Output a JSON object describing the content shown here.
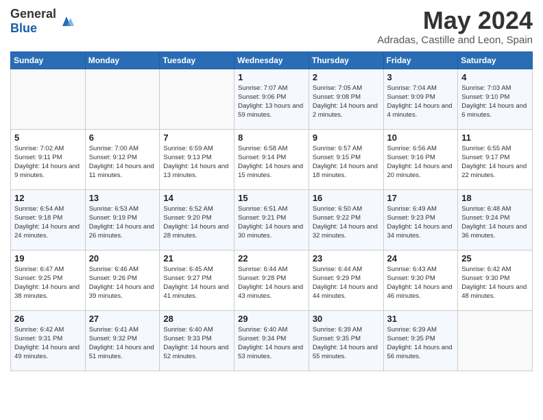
{
  "header": {
    "logo_general": "General",
    "logo_blue": "Blue",
    "month_title": "May 2024",
    "location": "Adradas, Castille and Leon, Spain"
  },
  "days_of_week": [
    "Sunday",
    "Monday",
    "Tuesday",
    "Wednesday",
    "Thursday",
    "Friday",
    "Saturday"
  ],
  "weeks": [
    [
      {
        "day": "",
        "sunrise": "",
        "sunset": "",
        "daylight": ""
      },
      {
        "day": "",
        "sunrise": "",
        "sunset": "",
        "daylight": ""
      },
      {
        "day": "",
        "sunrise": "",
        "sunset": "",
        "daylight": ""
      },
      {
        "day": "1",
        "sunrise": "Sunrise: 7:07 AM",
        "sunset": "Sunset: 9:06 PM",
        "daylight": "Daylight: 13 hours and 59 minutes."
      },
      {
        "day": "2",
        "sunrise": "Sunrise: 7:05 AM",
        "sunset": "Sunset: 9:08 PM",
        "daylight": "Daylight: 14 hours and 2 minutes."
      },
      {
        "day": "3",
        "sunrise": "Sunrise: 7:04 AM",
        "sunset": "Sunset: 9:09 PM",
        "daylight": "Daylight: 14 hours and 4 minutes."
      },
      {
        "day": "4",
        "sunrise": "Sunrise: 7:03 AM",
        "sunset": "Sunset: 9:10 PM",
        "daylight": "Daylight: 14 hours and 6 minutes."
      }
    ],
    [
      {
        "day": "5",
        "sunrise": "Sunrise: 7:02 AM",
        "sunset": "Sunset: 9:11 PM",
        "daylight": "Daylight: 14 hours and 9 minutes."
      },
      {
        "day": "6",
        "sunrise": "Sunrise: 7:00 AM",
        "sunset": "Sunset: 9:12 PM",
        "daylight": "Daylight: 14 hours and 11 minutes."
      },
      {
        "day": "7",
        "sunrise": "Sunrise: 6:59 AM",
        "sunset": "Sunset: 9:13 PM",
        "daylight": "Daylight: 14 hours and 13 minutes."
      },
      {
        "day": "8",
        "sunrise": "Sunrise: 6:58 AM",
        "sunset": "Sunset: 9:14 PM",
        "daylight": "Daylight: 14 hours and 15 minutes."
      },
      {
        "day": "9",
        "sunrise": "Sunrise: 6:57 AM",
        "sunset": "Sunset: 9:15 PM",
        "daylight": "Daylight: 14 hours and 18 minutes."
      },
      {
        "day": "10",
        "sunrise": "Sunrise: 6:56 AM",
        "sunset": "Sunset: 9:16 PM",
        "daylight": "Daylight: 14 hours and 20 minutes."
      },
      {
        "day": "11",
        "sunrise": "Sunrise: 6:55 AM",
        "sunset": "Sunset: 9:17 PM",
        "daylight": "Daylight: 14 hours and 22 minutes."
      }
    ],
    [
      {
        "day": "12",
        "sunrise": "Sunrise: 6:54 AM",
        "sunset": "Sunset: 9:18 PM",
        "daylight": "Daylight: 14 hours and 24 minutes."
      },
      {
        "day": "13",
        "sunrise": "Sunrise: 6:53 AM",
        "sunset": "Sunset: 9:19 PM",
        "daylight": "Daylight: 14 hours and 26 minutes."
      },
      {
        "day": "14",
        "sunrise": "Sunrise: 6:52 AM",
        "sunset": "Sunset: 9:20 PM",
        "daylight": "Daylight: 14 hours and 28 minutes."
      },
      {
        "day": "15",
        "sunrise": "Sunrise: 6:51 AM",
        "sunset": "Sunset: 9:21 PM",
        "daylight": "Daylight: 14 hours and 30 minutes."
      },
      {
        "day": "16",
        "sunrise": "Sunrise: 6:50 AM",
        "sunset": "Sunset: 9:22 PM",
        "daylight": "Daylight: 14 hours and 32 minutes."
      },
      {
        "day": "17",
        "sunrise": "Sunrise: 6:49 AM",
        "sunset": "Sunset: 9:23 PM",
        "daylight": "Daylight: 14 hours and 34 minutes."
      },
      {
        "day": "18",
        "sunrise": "Sunrise: 6:48 AM",
        "sunset": "Sunset: 9:24 PM",
        "daylight": "Daylight: 14 hours and 36 minutes."
      }
    ],
    [
      {
        "day": "19",
        "sunrise": "Sunrise: 6:47 AM",
        "sunset": "Sunset: 9:25 PM",
        "daylight": "Daylight: 14 hours and 38 minutes."
      },
      {
        "day": "20",
        "sunrise": "Sunrise: 6:46 AM",
        "sunset": "Sunset: 9:26 PM",
        "daylight": "Daylight: 14 hours and 39 minutes."
      },
      {
        "day": "21",
        "sunrise": "Sunrise: 6:45 AM",
        "sunset": "Sunset: 9:27 PM",
        "daylight": "Daylight: 14 hours and 41 minutes."
      },
      {
        "day": "22",
        "sunrise": "Sunrise: 6:44 AM",
        "sunset": "Sunset: 9:28 PM",
        "daylight": "Daylight: 14 hours and 43 minutes."
      },
      {
        "day": "23",
        "sunrise": "Sunrise: 6:44 AM",
        "sunset": "Sunset: 9:29 PM",
        "daylight": "Daylight: 14 hours and 44 minutes."
      },
      {
        "day": "24",
        "sunrise": "Sunrise: 6:43 AM",
        "sunset": "Sunset: 9:30 PM",
        "daylight": "Daylight: 14 hours and 46 minutes."
      },
      {
        "day": "25",
        "sunrise": "Sunrise: 6:42 AM",
        "sunset": "Sunset: 9:30 PM",
        "daylight": "Daylight: 14 hours and 48 minutes."
      }
    ],
    [
      {
        "day": "26",
        "sunrise": "Sunrise: 6:42 AM",
        "sunset": "Sunset: 9:31 PM",
        "daylight": "Daylight: 14 hours and 49 minutes."
      },
      {
        "day": "27",
        "sunrise": "Sunrise: 6:41 AM",
        "sunset": "Sunset: 9:32 PM",
        "daylight": "Daylight: 14 hours and 51 minutes."
      },
      {
        "day": "28",
        "sunrise": "Sunrise: 6:40 AM",
        "sunset": "Sunset: 9:33 PM",
        "daylight": "Daylight: 14 hours and 52 minutes."
      },
      {
        "day": "29",
        "sunrise": "Sunrise: 6:40 AM",
        "sunset": "Sunset: 9:34 PM",
        "daylight": "Daylight: 14 hours and 53 minutes."
      },
      {
        "day": "30",
        "sunrise": "Sunrise: 6:39 AM",
        "sunset": "Sunset: 9:35 PM",
        "daylight": "Daylight: 14 hours and 55 minutes."
      },
      {
        "day": "31",
        "sunrise": "Sunrise: 6:39 AM",
        "sunset": "Sunset: 9:35 PM",
        "daylight": "Daylight: 14 hours and 56 minutes."
      },
      {
        "day": "",
        "sunrise": "",
        "sunset": "",
        "daylight": ""
      }
    ]
  ]
}
